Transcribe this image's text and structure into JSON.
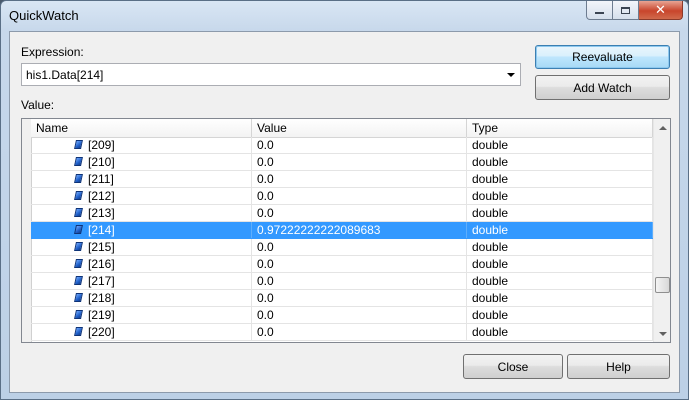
{
  "window": {
    "title": "QuickWatch"
  },
  "expression": {
    "label": "Expression:",
    "value": "his1.Data[214]"
  },
  "buttons": {
    "reevaluate": "Reevaluate",
    "add_watch": "Add Watch",
    "close": "Close",
    "help": "Help"
  },
  "value_section": {
    "label": "Value:",
    "columns": {
      "name": "Name",
      "value": "Value",
      "type": "Type"
    },
    "rows": [
      {
        "name": "[209]",
        "value": "0.0",
        "type": "double",
        "selected": false
      },
      {
        "name": "[210]",
        "value": "0.0",
        "type": "double",
        "selected": false
      },
      {
        "name": "[211]",
        "value": "0.0",
        "type": "double",
        "selected": false
      },
      {
        "name": "[212]",
        "value": "0.0",
        "type": "double",
        "selected": false
      },
      {
        "name": "[213]",
        "value": "0.0",
        "type": "double",
        "selected": false
      },
      {
        "name": "[214]",
        "value": "0.97222222222089683",
        "type": "double",
        "selected": true
      },
      {
        "name": "[215]",
        "value": "0.0",
        "type": "double",
        "selected": false
      },
      {
        "name": "[216]",
        "value": "0.0",
        "type": "double",
        "selected": false
      },
      {
        "name": "[217]",
        "value": "0.0",
        "type": "double",
        "selected": false
      },
      {
        "name": "[218]",
        "value": "0.0",
        "type": "double",
        "selected": false
      },
      {
        "name": "[219]",
        "value": "0.0",
        "type": "double",
        "selected": false
      },
      {
        "name": "[220]",
        "value": "0.0",
        "type": "double",
        "selected": false
      }
    ],
    "row_icon": "field-member-icon",
    "selection_color": "#3399ff"
  }
}
